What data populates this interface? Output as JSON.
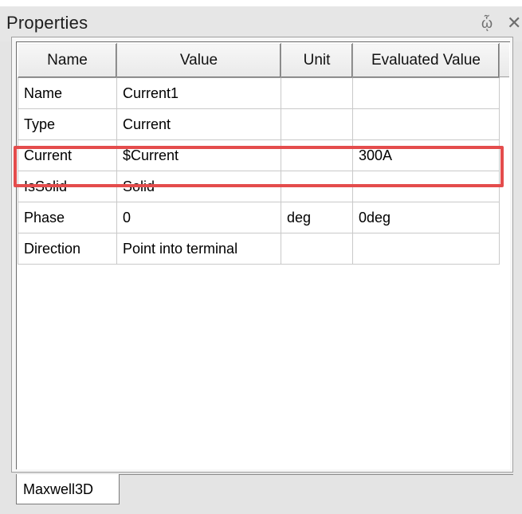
{
  "panel": {
    "title": "Properties",
    "pin_icon": "pin-icon",
    "close_icon": "close-icon"
  },
  "table": {
    "headers": [
      "Name",
      "Value",
      "Unit",
      "Evaluated Value"
    ],
    "rows": [
      [
        "Name",
        "Current1",
        "",
        ""
      ],
      [
        "Type",
        "Current",
        "",
        ""
      ],
      [
        "Current",
        "$Current",
        "",
        "300A"
      ],
      [
        "IsSolid",
        "Solid",
        "",
        ""
      ],
      [
        "Phase",
        "0",
        "deg",
        "0deg"
      ],
      [
        "Direction",
        "Point into terminal",
        "",
        ""
      ]
    ]
  },
  "tabs": [
    "Maxwell3D"
  ],
  "colors": {
    "highlight": "#e44c4c"
  }
}
